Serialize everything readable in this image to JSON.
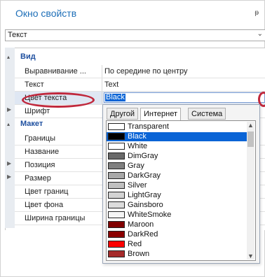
{
  "window": {
    "title": "Окно свойств",
    "pin_glyph": "ᵽ"
  },
  "selector": {
    "value": "Текст",
    "arrow": "⌄"
  },
  "grid": {
    "cat_view": "Вид",
    "rows_view": [
      {
        "name": "Выравнивание ...",
        "value": "По середине по центру"
      },
      {
        "name": "Текст",
        "value": "Text"
      },
      {
        "name": "Цвет текста",
        "value": "Black"
      },
      {
        "name": "Шрифт",
        "value": ""
      }
    ],
    "cat_layout": "Макет",
    "rows_layout": [
      {
        "name": "Границы"
      },
      {
        "name": "Название"
      },
      {
        "name": "Позиция"
      },
      {
        "name": "Размер"
      },
      {
        "name": "Цвет границ"
      },
      {
        "name": "Цвет фона"
      },
      {
        "name": "Ширина границы"
      }
    ]
  },
  "popup": {
    "tabs": [
      "Другой",
      "Интернет",
      "Система"
    ],
    "active_tab": 1,
    "selected_index": 1,
    "colors": [
      {
        "name": "Transparent",
        "hex": "#ffffff"
      },
      {
        "name": "Black",
        "hex": "#000000"
      },
      {
        "name": "White",
        "hex": "#ffffff"
      },
      {
        "name": "DimGray",
        "hex": "#696969"
      },
      {
        "name": "Gray",
        "hex": "#808080"
      },
      {
        "name": "DarkGray",
        "hex": "#a9a9a9"
      },
      {
        "name": "Silver",
        "hex": "#c0c0c0"
      },
      {
        "name": "LightGray",
        "hex": "#d3d3d3"
      },
      {
        "name": "Gainsboro",
        "hex": "#dcdcdc"
      },
      {
        "name": "WhiteSmoke",
        "hex": "#f5f5f5"
      },
      {
        "name": "Maroon",
        "hex": "#800000"
      },
      {
        "name": "DarkRed",
        "hex": "#8b0000"
      },
      {
        "name": "Red",
        "hex": "#ff0000"
      },
      {
        "name": "Brown",
        "hex": "#a52a2a"
      }
    ]
  }
}
